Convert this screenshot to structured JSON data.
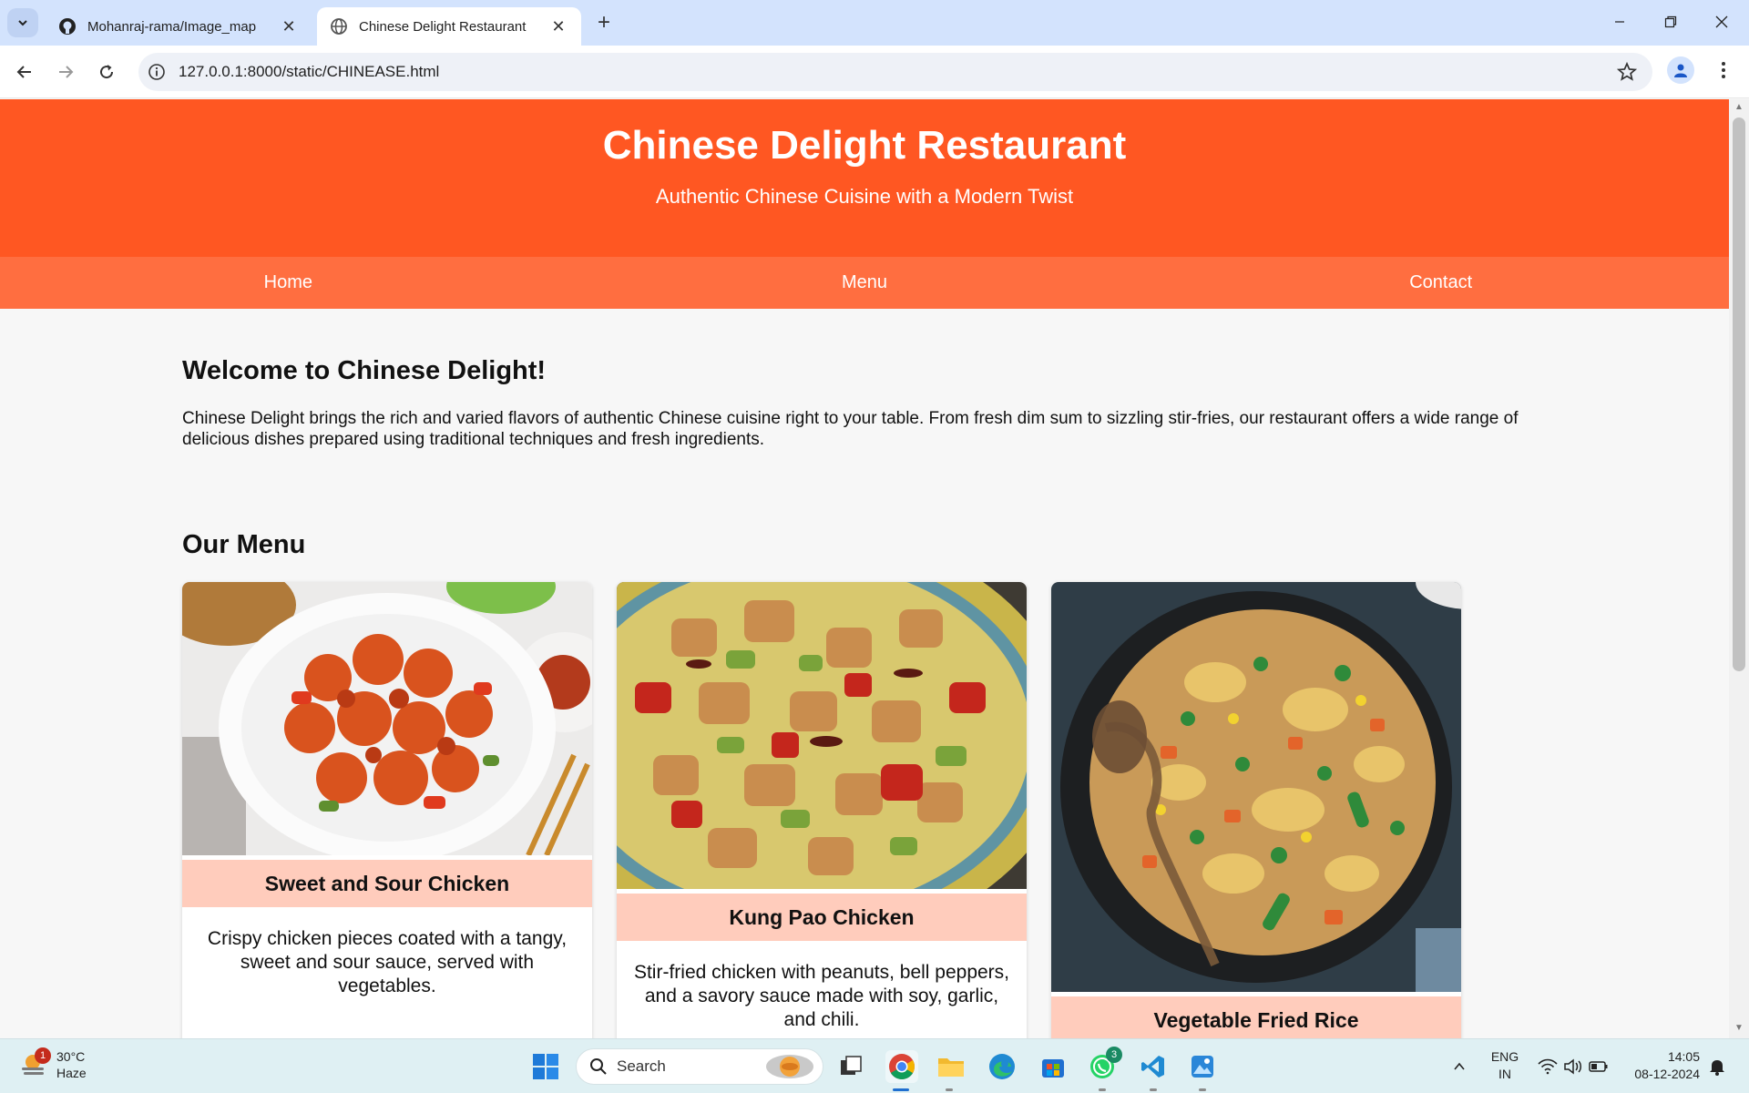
{
  "browser": {
    "tabs": [
      {
        "title": "Mohanraj-rama/Image_map",
        "active": false
      },
      {
        "title": "Chinese Delight Restaurant",
        "active": true
      }
    ],
    "url": "127.0.0.1:8000/static/CHINEASE.html"
  },
  "page": {
    "header": {
      "title": "Chinese Delight Restaurant",
      "tagline": "Authentic Chinese Cuisine with a Modern Twist"
    },
    "nav": [
      "Home",
      "Menu",
      "Contact"
    ],
    "welcome": {
      "heading": "Welcome to Chinese Delight!",
      "text": "Chinese Delight brings the rich and varied flavors of authentic Chinese cuisine right to your table. From fresh dim sum to sizzling stir-fries, our restaurant offers a wide range of delicious dishes prepared using traditional techniques and fresh ingredients."
    },
    "menu": {
      "heading": "Our Menu",
      "items": [
        {
          "name": "Sweet and Sour Chicken",
          "description": "Crispy chicken pieces coated with a tangy, sweet and sour sauce, served with vegetables."
        },
        {
          "name": "Kung Pao Chicken",
          "description": "Stir-fried chicken with peanuts, bell peppers, and a savory sauce made with soy, garlic, and chili."
        },
        {
          "name": "Vegetable Fried Rice",
          "description": ""
        }
      ]
    },
    "colors": {
      "header": "#ff5722",
      "nav": "#ff6e40",
      "card_title": "#ffccbc"
    }
  },
  "taskbar": {
    "weather": {
      "temp": "30°C",
      "condition": "Haze",
      "badge": "1"
    },
    "search_label": "Search",
    "whatsapp_badge": "3",
    "language": {
      "line1": "ENG",
      "line2": "IN"
    },
    "time": "14:05",
    "date": "08-12-2024"
  }
}
